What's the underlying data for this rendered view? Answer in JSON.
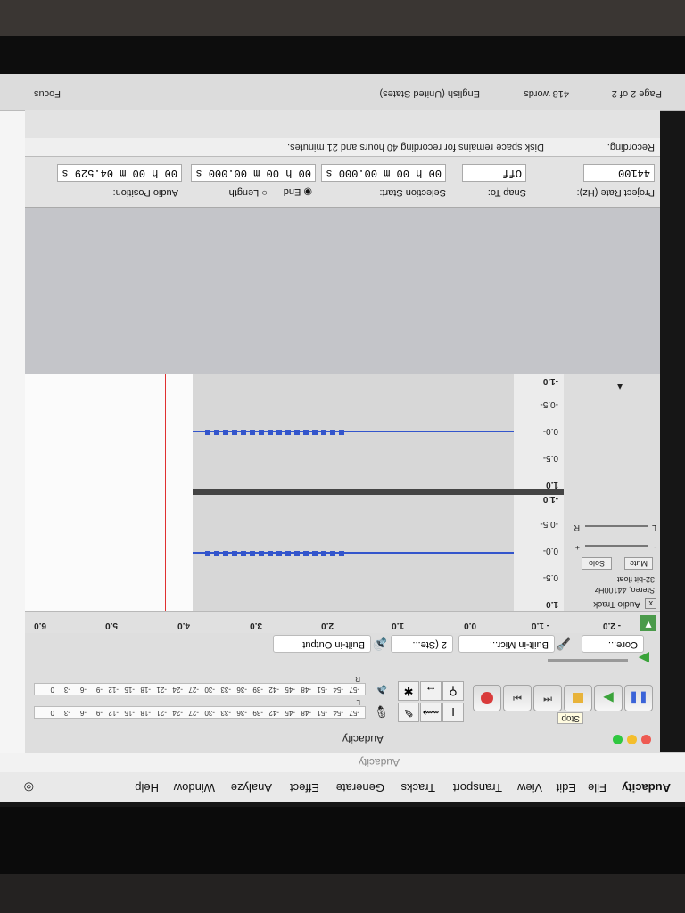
{
  "menu": {
    "app": "Audacity",
    "items": [
      "File",
      "Edit",
      "View",
      "Transport",
      "Tracks",
      "Generate",
      "Effect",
      "Analyze",
      "Window",
      "Help"
    ]
  },
  "window_title": "Audacity",
  "transport": {
    "tooltip": "Stop"
  },
  "meters": {
    "record_ticks": [
      "-57",
      "-54",
      "-51",
      "-48",
      "-45",
      "-42",
      "-39",
      "-36",
      "-33",
      "-30",
      "-27",
      "-24",
      "-21",
      "-18",
      "-15",
      "-12",
      "-9",
      "-6",
      "-3",
      "0"
    ],
    "play_ticks": [
      "-57",
      "-54",
      "-51",
      "-48",
      "-45",
      "-42",
      "-39",
      "-36",
      "-33",
      "-30",
      "-27",
      "-24",
      "-21",
      "-18",
      "-15",
      "-12",
      "-9",
      "-6",
      "-3",
      "0"
    ],
    "lr_top": "L",
    "lr_bottom": "R"
  },
  "devices": {
    "host": "Core...",
    "recording_device": "Built-in Micr...",
    "channels": "2 (Ste...",
    "playback_device": "Built-in Output"
  },
  "timeline": [
    "- 2.0",
    "- 1.0",
    "0.0",
    "1.0",
    "2.0",
    "3.0",
    "4.0",
    "5.0",
    "6.0"
  ],
  "track": {
    "name": "Audio Track",
    "close": "x",
    "info1": "Stereo, 44100Hz",
    "info2": "32-bit float",
    "mute": "Mute",
    "solo": "Solo",
    "gain_minus": "-",
    "gain_plus": "+",
    "pan_left": "L",
    "pan_right": "R",
    "scale": [
      "1.0",
      "0.5-",
      "0.0-",
      "-0.5-",
      "-1.0"
    ]
  },
  "selection": {
    "project_rate_label": "Project Rate (Hz):",
    "project_rate": "44100",
    "snap_label": "Snap To:",
    "snap_value": "Off",
    "selection_start_label": "Selection Start:",
    "selection_start": "00 h 00 m 00.000 s",
    "end_label": "End",
    "length_label": "Length",
    "selection_end": "00 h 00 m 00.000 s",
    "audio_position_label": "Audio Position:",
    "audio_position": "00 h 00 m 04.529 s",
    "status": "Recording.",
    "disk_space": "Disk space remains for recording 40 hours and 21 minutes."
  },
  "word": {
    "page": "Page 2 of 2",
    "words": "418 words",
    "language": "English (United States)",
    "focus": "Focus"
  },
  "colors": {
    "waveform": "#3355cc",
    "record": "#d93b3b",
    "play": "#3aa33a",
    "pause": "#3a63d8",
    "cursor": "#e03030"
  }
}
